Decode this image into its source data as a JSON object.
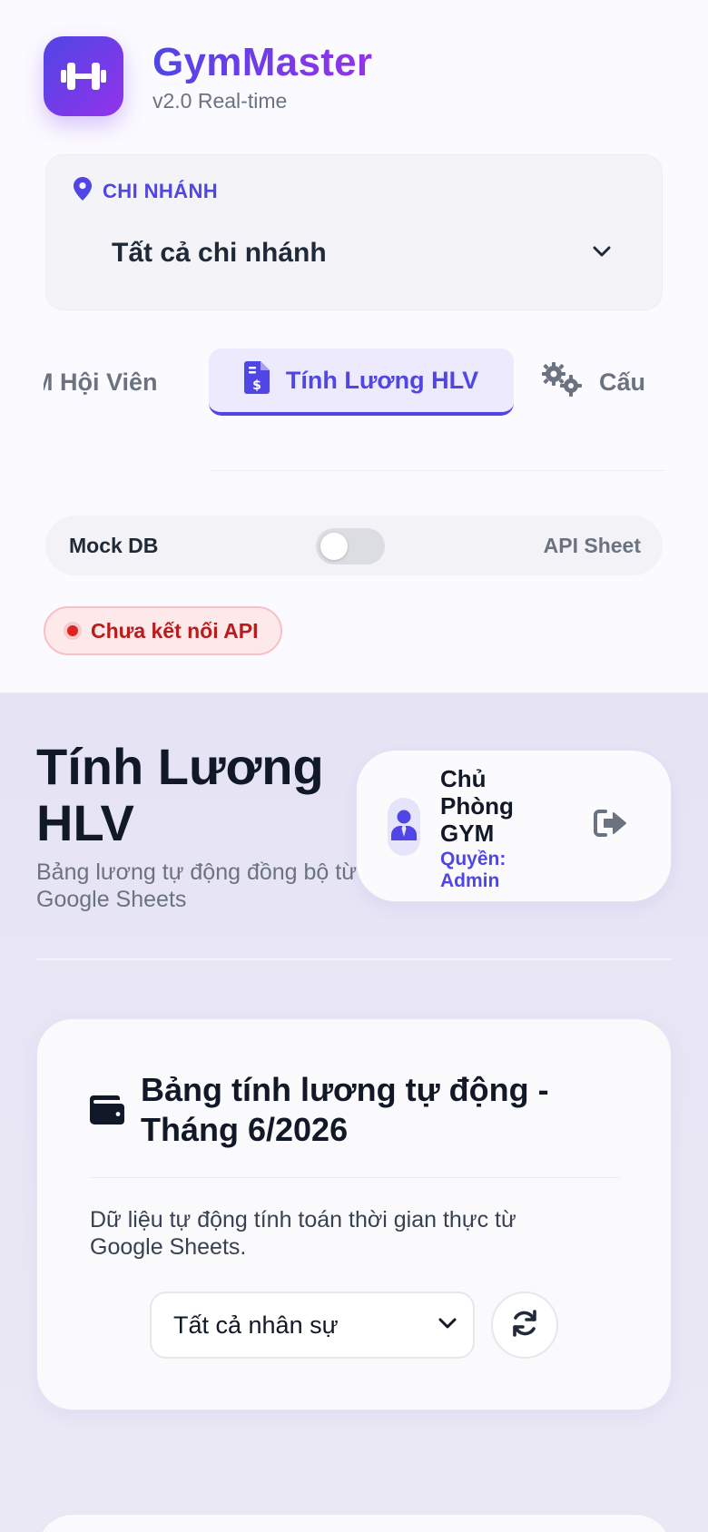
{
  "sidebar": {
    "brand": {
      "name": "GymMaster",
      "version": "v2.0 Real-time"
    },
    "branch": {
      "label": "CHI NHÁNH",
      "selected": "Tất cả chi nhánh"
    },
    "tabs": [
      {
        "label": "M Hội Viên",
        "icon": "members-icon",
        "active": false
      },
      {
        "label": "Tính Lương HLV",
        "icon": "invoice-dollar-icon",
        "active": true
      },
      {
        "label": "Cấu",
        "icon": "cogs-icon",
        "active": false
      }
    ],
    "data_source": {
      "left_label": "Mock DB",
      "right_label": "API Sheet",
      "toggle_on": false
    },
    "status": {
      "text": "Chưa kết nối API",
      "color": "#dc2626"
    }
  },
  "header": {
    "title": "Tính Lương HLV",
    "subtitle": "Bảng lương tự động đồng bộ từ Google Sheets",
    "user": {
      "name": "Chủ Phòng GYM",
      "role": "Quyền: Admin"
    }
  },
  "salary_card": {
    "title": "Bảng tính lương tự động - Tháng 6/2026",
    "description": "Dữ liệu tự động tính toán thời gian thực từ Google Sheets.",
    "staff_filter": {
      "selected": "Tất cả nhân sự"
    }
  },
  "theme": {
    "accent": "#4f46e5",
    "accent_secondary": "#9333ea",
    "danger": "#dc2626"
  }
}
